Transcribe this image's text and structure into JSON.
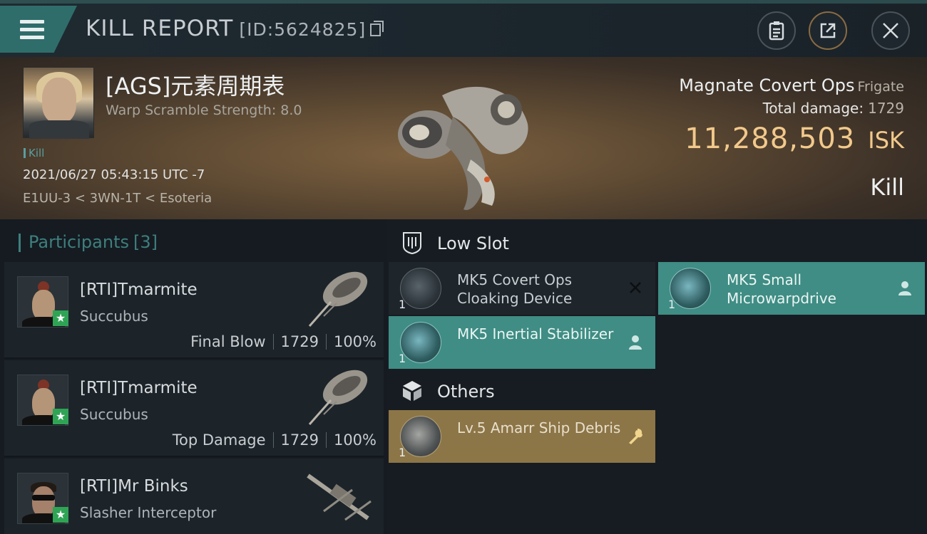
{
  "header": {
    "title": "KILL REPORT",
    "report_id": "[ID:5624825]"
  },
  "victim": {
    "name": "[AGS]元素周期表",
    "warp_scramble": "Warp Scramble Strength: 8.0",
    "tag": "Kill",
    "datetime": "2021/06/27 05:43:15 UTC -7",
    "location": "E1UU-3 < 3WN-1T < Esoteria",
    "ship_name": "Magnate Covert Ops",
    "ship_class": "Frigate",
    "total_damage_label": "Total damage:",
    "total_damage": "1729",
    "isk_value": "11,288,503",
    "isk_unit": "ISK",
    "result": "Kill"
  },
  "participants": {
    "title": "Participants",
    "count": "[3]",
    "items": [
      {
        "name": "[RTI]Tmarmite",
        "ship": "Succubus",
        "role": "Final Blow",
        "damage": "1729",
        "percent": "100%"
      },
      {
        "name": "[RTI]Tmarmite",
        "ship": "Succubus",
        "role": "Top Damage",
        "damage": "1729",
        "percent": "100%"
      },
      {
        "name": "[RTI]Mr Binks",
        "ship": "Slasher Interceptor",
        "role": "",
        "damage": "",
        "percent": ""
      }
    ]
  },
  "fittings": {
    "low_slot_label": "Low Slot",
    "others_label": "Others",
    "low_slot": [
      {
        "name": "MK5 Covert Ops Cloaking Device",
        "qty": "1",
        "status": "destroyed"
      },
      {
        "name": "MK5 Small Microwarpdrive",
        "qty": "1",
        "status": "dropped"
      },
      {
        "name": "MK5 Inertial Stabilizer",
        "qty": "1",
        "status": "dropped"
      }
    ],
    "others": [
      {
        "name": "Lv.5 Amarr Ship Debris",
        "qty": "1",
        "status": "salvage"
      }
    ]
  },
  "colors": {
    "accent_teal": "#3f8d84",
    "isk_gold": "#f2c98b",
    "salvage_gold": "#8c7547",
    "badge_green": "#2fa455"
  }
}
